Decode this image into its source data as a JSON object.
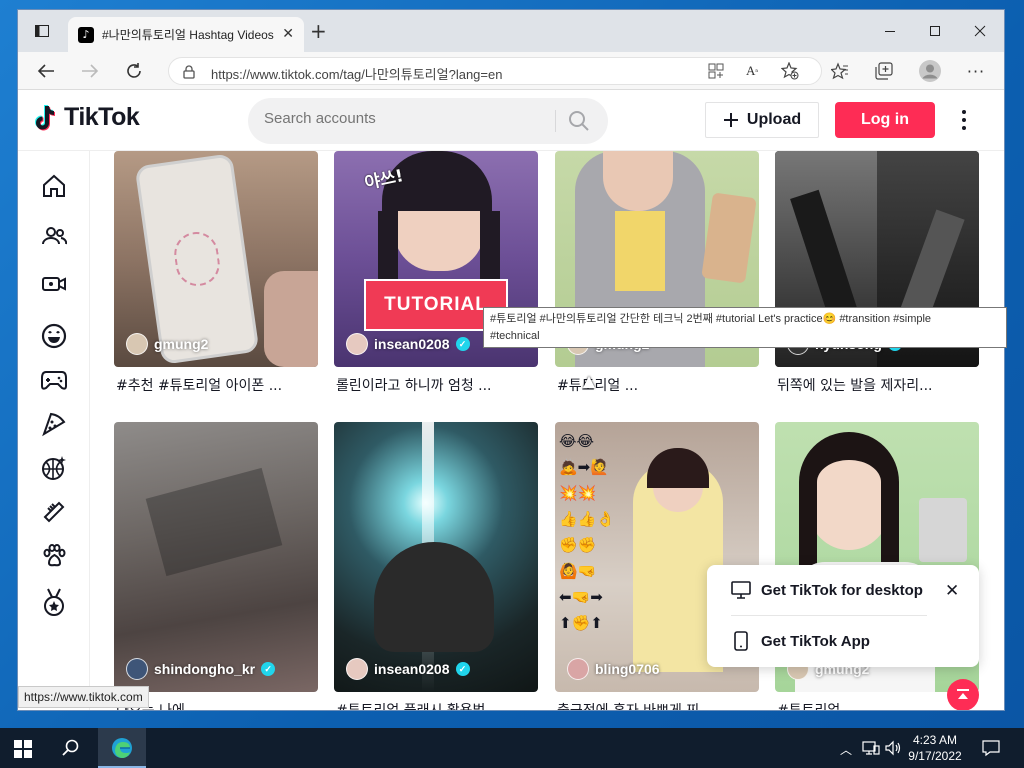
{
  "browser": {
    "tab_title": "#나만의튜토리얼 Hashtag Videos",
    "url": "https://www.tiktok.com/tag/나만의튜토리얼?lang=en",
    "status_url": "https://www.tiktok.com"
  },
  "header": {
    "logo_text": "TikTok",
    "search_placeholder": "Search accounts",
    "upload_label": "Upload",
    "login_label": "Log in"
  },
  "sidebar": {
    "icons": [
      "home-icon",
      "following-icon",
      "live-icon",
      "comedy-icon",
      "gaming-icon",
      "food-icon",
      "sports-icon",
      "beauty-icon",
      "animals-icon",
      "achievement-icon"
    ]
  },
  "videos": [
    {
      "user": "gmung2",
      "verified": false,
      "desc": "#추천 #튜토리얼 아이폰 ..."
    },
    {
      "user": "insean0208",
      "verified": true,
      "desc": "롤린이라고 하니까 엄청 ...",
      "overlay_text": "TUTORIAL",
      "sticker_text": "야쓰!"
    },
    {
      "user": "gmung2",
      "verified": false,
      "desc": "#튜토리얼 ..."
    },
    {
      "user": "hyunsong",
      "verified": true,
      "desc": "뒤쪽에 있는 발을 제자리..."
    },
    {
      "user": "shindongho_kr",
      "verified": true,
      "desc": "나오는 나에"
    },
    {
      "user": "insean0208",
      "verified": true,
      "desc": "#튜토리얼 플래시 활용법..."
    },
    {
      "user": "bling0706",
      "verified": false,
      "desc": "출근전에 혼자 바쁘게 찌..."
    },
    {
      "user": "gmung2",
      "verified": false,
      "desc": "#튜토리얼"
    }
  ],
  "tooltip": {
    "line1": "#튜토리얼 #나만의튜토리얼 간단한 테크닉 2번째 #tutorial Let's practice😊 #transition #simple",
    "line2": "#technical"
  },
  "popup": {
    "desktop_label": "Get TikTok for desktop",
    "app_label": "Get TikTok App"
  },
  "taskbar": {
    "time": "4:23 AM",
    "date": "9/17/2022"
  },
  "colors": {
    "brand": "#fe2c55",
    "verified": "#20d5ec",
    "taskbar": "#101d2d"
  }
}
